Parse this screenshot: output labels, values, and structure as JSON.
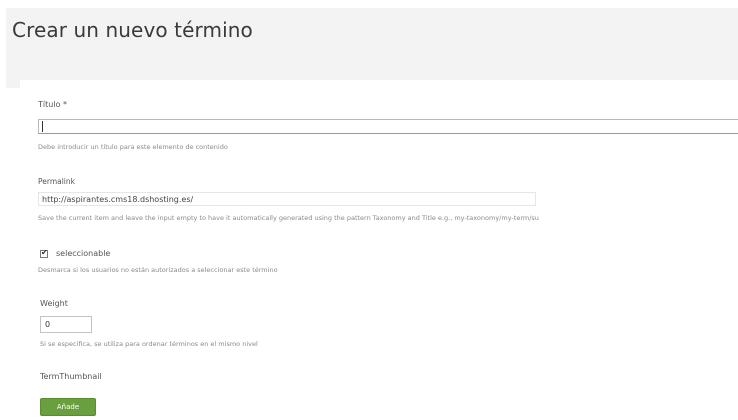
{
  "page": {
    "title": "Crear un nuevo término"
  },
  "form": {
    "titulo": {
      "label": "Título *",
      "value": "",
      "hint": "Debe introducir un título para este elemento de contenido"
    },
    "permalink": {
      "label": "Permalink",
      "value": "http://aspirantes.cms18.dshosting.es/",
      "hint": "Save the current item and leave the input empty to have it automatically generated using the pattern Taxonomy and Title e.g., my-taxonomy/my-term/su"
    },
    "seleccionable": {
      "label": "seleccionable",
      "checked": true,
      "hint": "Desmarca si los usuarios no están autorizados a seleccionar este término"
    },
    "weight": {
      "label": "Weight",
      "value": "0",
      "hint": "Si se especifica, se utiliza para ordenar términos en el mismo nivel"
    },
    "thumbnail": {
      "label": "TermThumbnail",
      "button_label": "Añade"
    }
  },
  "colors": {
    "accent_button": "#6a9f3f",
    "header_band": "#f3f3f3"
  }
}
